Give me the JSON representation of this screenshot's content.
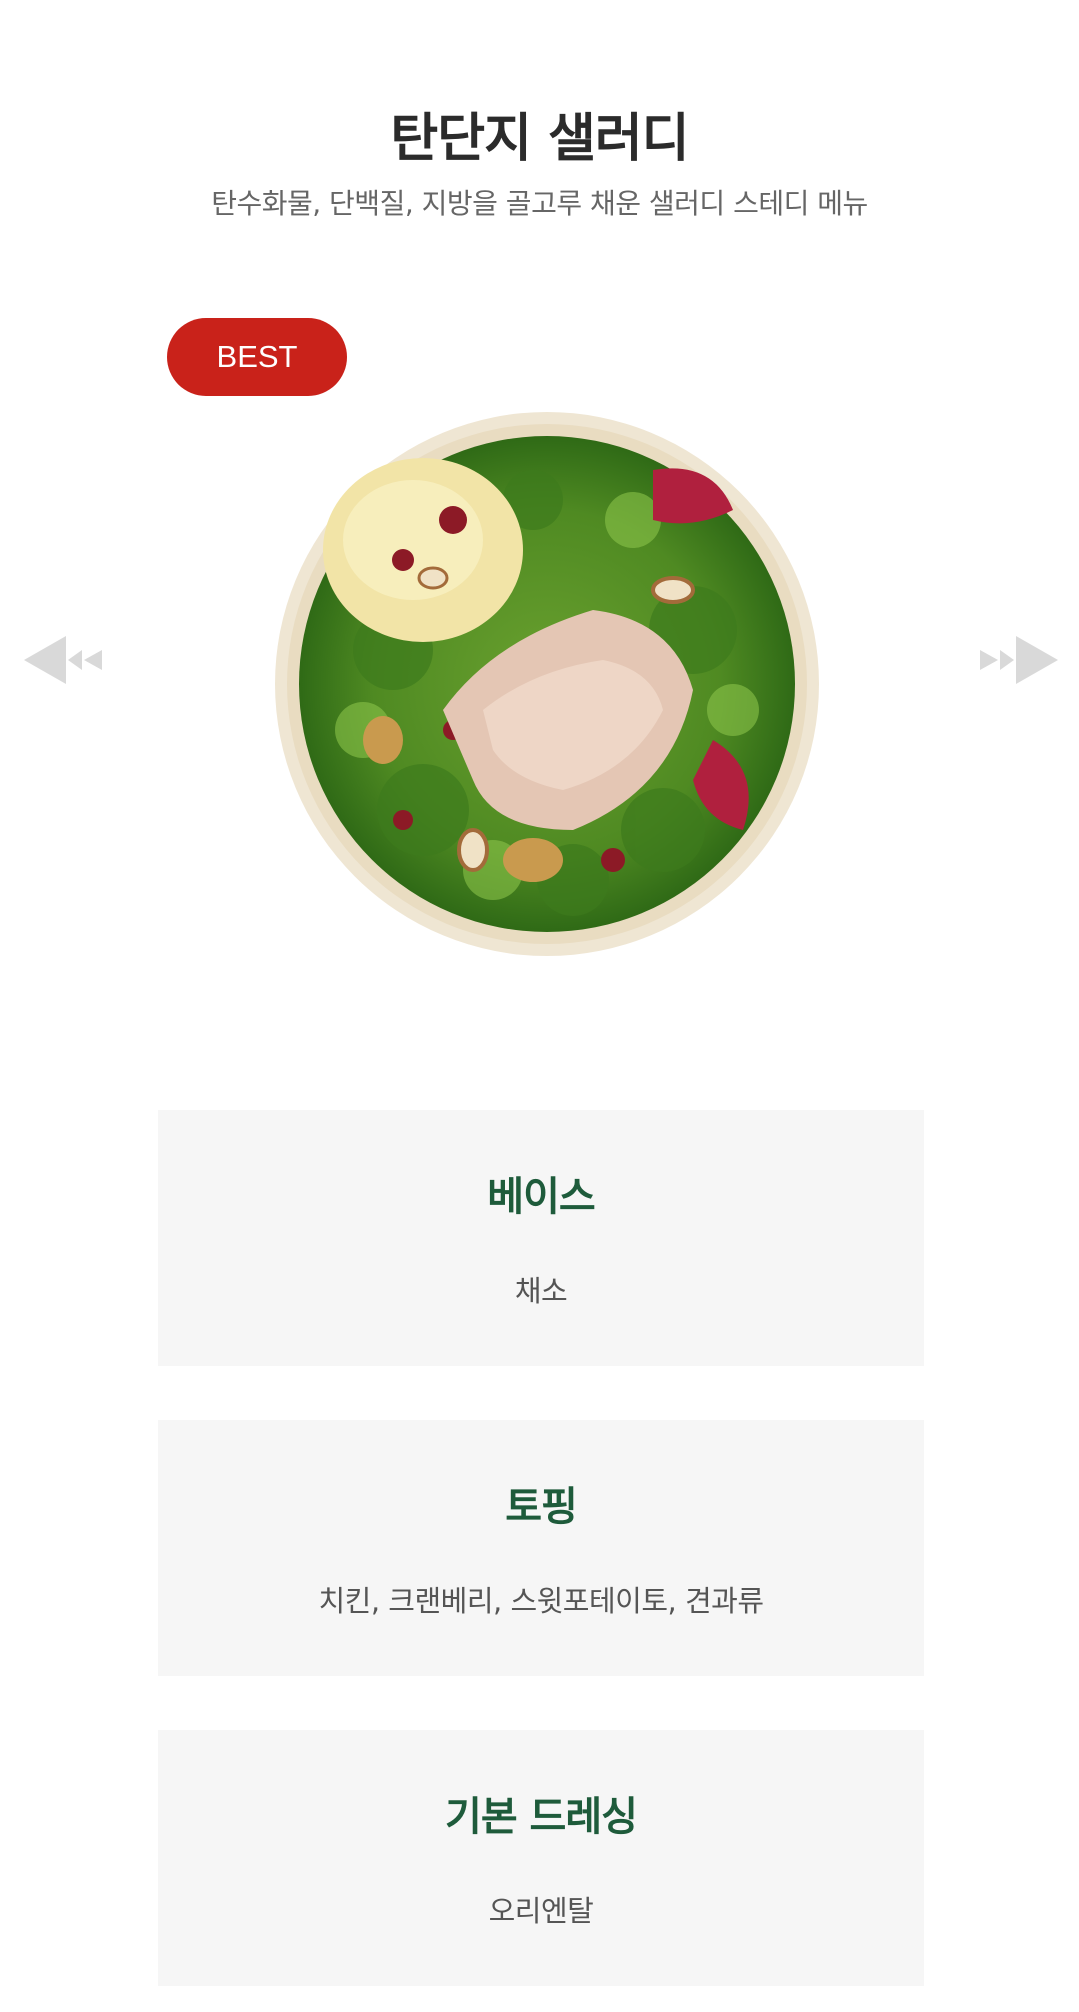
{
  "product": {
    "title": "탄단지 샐러디",
    "subtitle": "탄수화물, 단백질, 지방을 골고루 채운 샐러디 스테디 메뉴",
    "badge": "BEST",
    "badge_color": "#c9221a",
    "image": "salad-bowl-image"
  },
  "carousel": {
    "prev_icon": "prev-arrow-icon",
    "next_icon": "next-arrow-icon"
  },
  "info": [
    {
      "label": "베이스",
      "value": "채소"
    },
    {
      "label": "토핑",
      "value": "치킨, 크랜베리, 스윗포테이토, 견과류"
    },
    {
      "label": "기본 드레싱",
      "value": "오리엔탈"
    }
  ],
  "colors": {
    "heading_green": "#1e5b3b",
    "card_bg": "#f6f6f6"
  }
}
